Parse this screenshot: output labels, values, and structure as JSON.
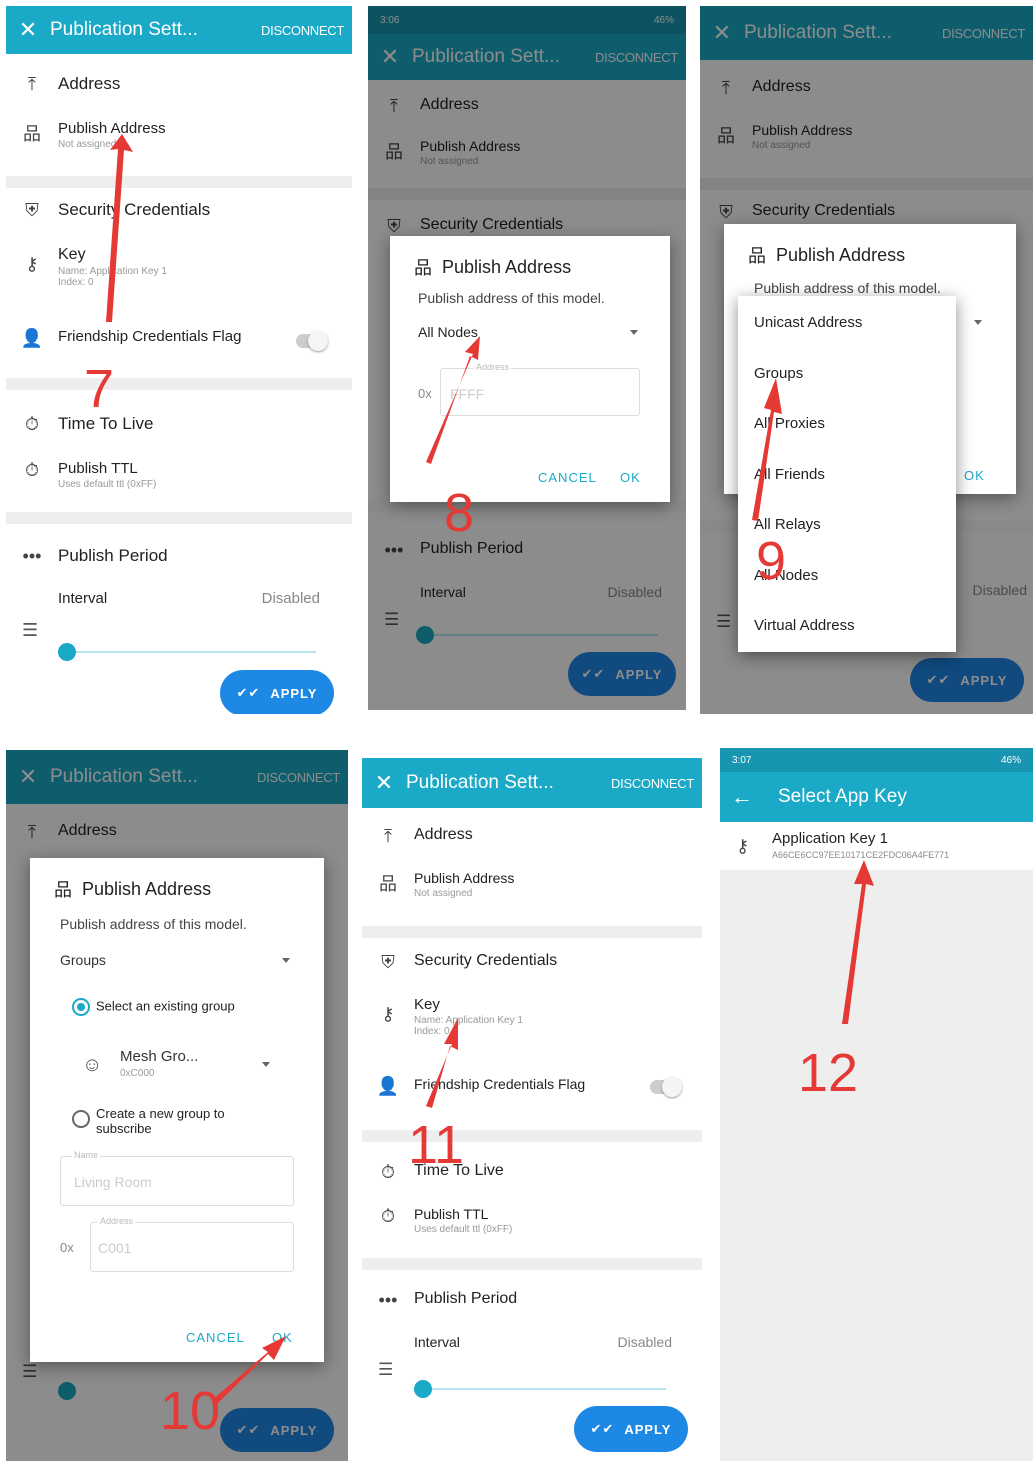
{
  "settings": {
    "close_glyph": "✕",
    "title": "Publication Sett...",
    "disconnect": "DISCONNECT",
    "address_header": "Address",
    "publish_address_label": "Publish Address",
    "publish_address_value": "Not assigned",
    "security_header": "Security Credentials",
    "key_label": "Key",
    "key_name": "Name: Application Key 1",
    "key_index": "Index: 0",
    "friendship_label": "Friendship Credentials Flag",
    "ttl_header": "Time To Live",
    "publish_ttl_label": "Publish TTL",
    "publish_ttl_value": "Uses default ttl (0xFF)",
    "period_header": "Publish Period",
    "interval_label": "Interval",
    "interval_value": "Disabled",
    "apply": "APPLY",
    "interval_slider_level": 0
  },
  "status_bar": {
    "time_a": "3:06",
    "time_b": "3:07",
    "battery": "46%"
  },
  "dialog_publish_address": {
    "title": "Publish Address",
    "message": "Publish address of this model.",
    "selected_all_nodes": "All Nodes",
    "address_label": "Address",
    "prefix": "0x",
    "address_value": "FFFF",
    "cancel": "CANCEL",
    "ok": "OK"
  },
  "address_menu": {
    "items": [
      "Unicast Address",
      "Groups",
      "All Proxies",
      "All Friends",
      "All Relays",
      "All Nodes",
      "Virtual Address"
    ]
  },
  "dialog_groups": {
    "selected": "Groups",
    "existing_option": "Select an existing group",
    "group_name": "Mesh Gro...",
    "group_address": "0xC000",
    "new_option": "Create a new group to subscribe",
    "name_label": "Name",
    "name_placeholder": "Living Room",
    "address_label": "Address",
    "prefix": "0x",
    "address_placeholder": "C001"
  },
  "select_app_key": {
    "back_glyph": "←",
    "title": "Select App Key",
    "key_name": "Application Key 1",
    "key_value": "A66CE6CC97EE10171CE2FDC06A4FE771"
  },
  "steps": [
    "7",
    "8",
    "9",
    "10",
    "11",
    "12"
  ],
  "colors": {
    "toolbar": "#1aa9c7",
    "accent": "#1aa9c7",
    "apply_button": "#1e88e5",
    "annotation": "#e53935"
  },
  "icons": {
    "address": "upload-icon",
    "publish_address": "network-icon",
    "security": "shield-icon",
    "key": "key-icon",
    "friendship": "friend-icon",
    "ttl": "timer-icon",
    "period": "dots-icon",
    "list": "list-icon",
    "check": "double-check-icon"
  }
}
